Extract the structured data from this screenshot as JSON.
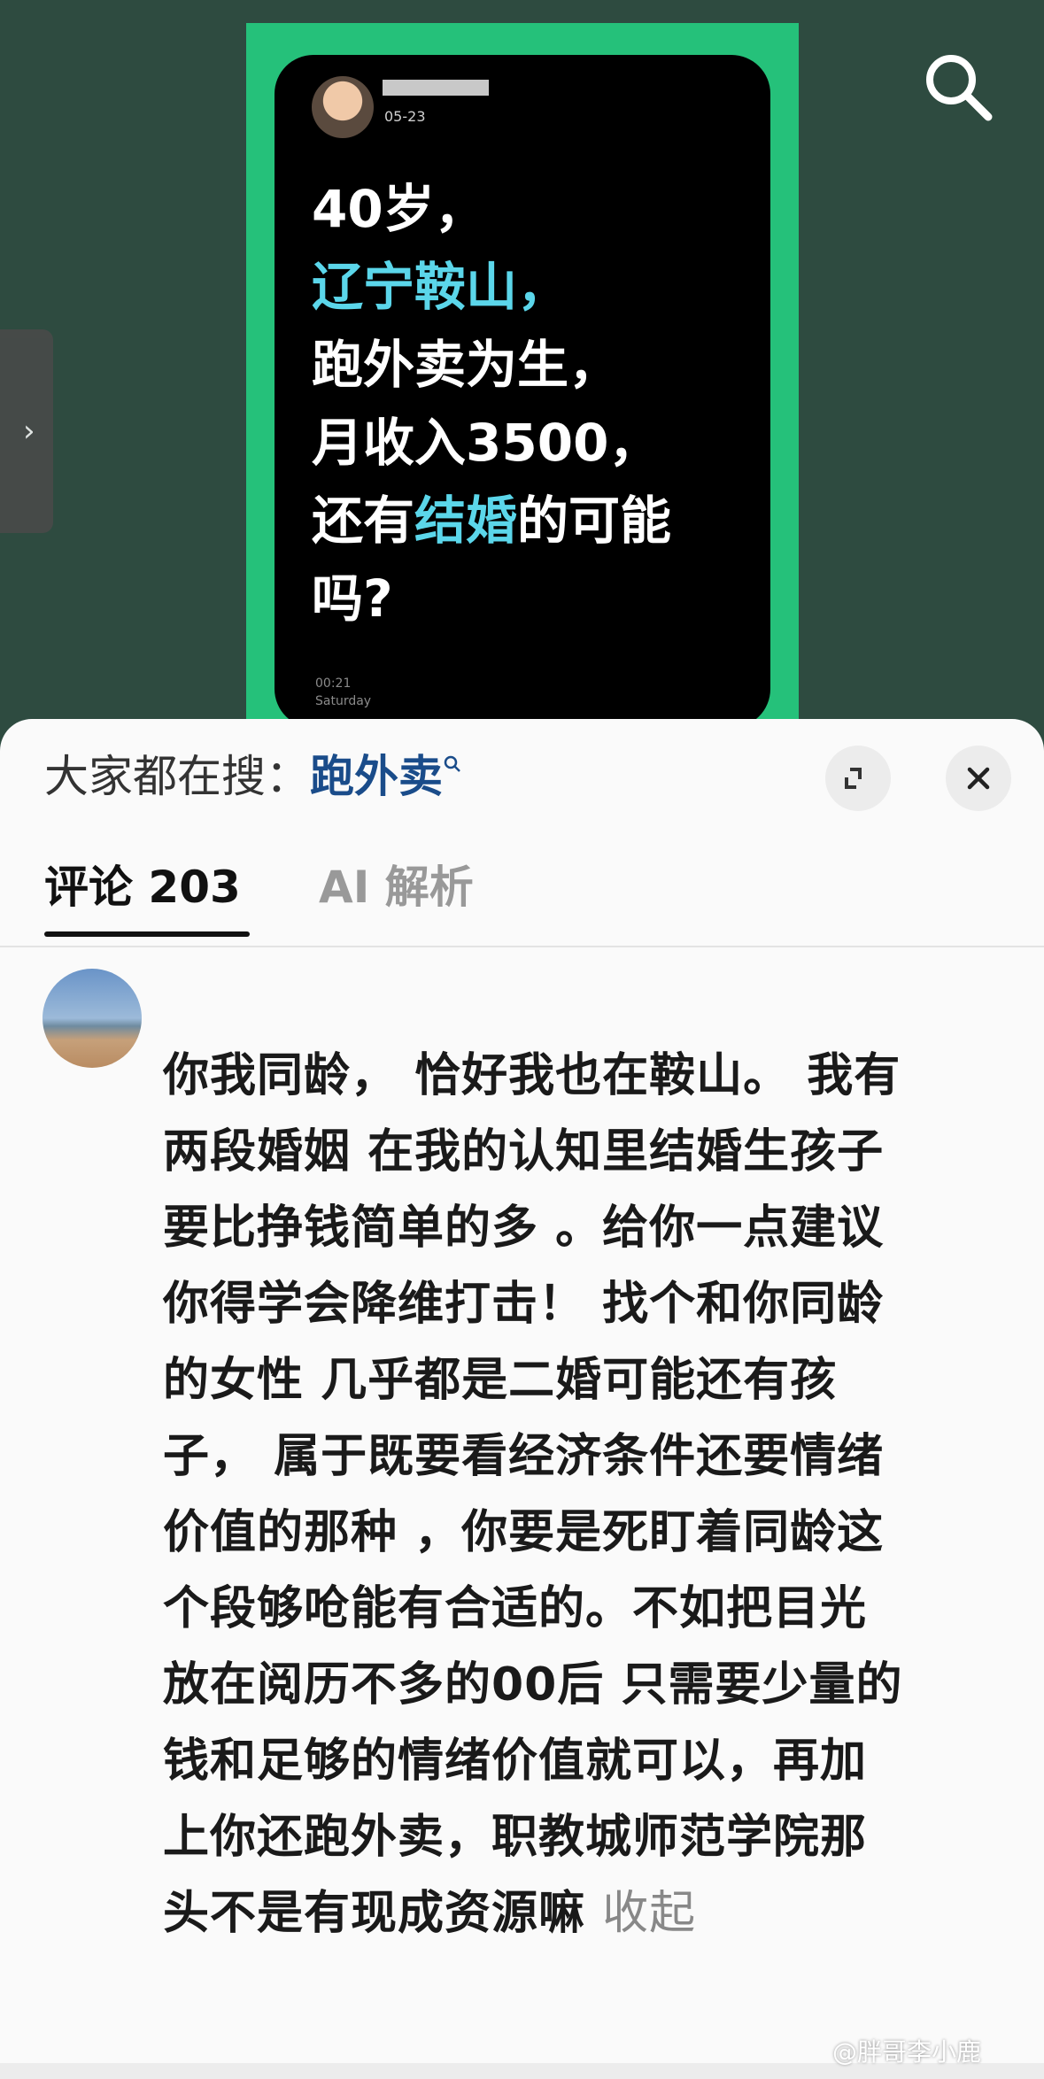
{
  "video": {
    "date": "05-23",
    "headline": {
      "line1": "40岁，",
      "line2": "辽宁鞍山，",
      "line3": "跑外卖为生，",
      "line4": "月收入3500，",
      "line5_a": "还有",
      "line5_b": "结婚",
      "line5_c": "的可能",
      "line6": "吗?"
    },
    "time": "00:21",
    "day": "Saturday",
    "highlight_color": "#5bd6ea"
  },
  "search": {
    "prefix": "大家都在搜：",
    "keyword": "跑外卖",
    "keyword_color": "#1a4c8a"
  },
  "tabs": {
    "comments": "评论 203",
    "ai": "AI 解析"
  },
  "comment": {
    "lines": [
      "你我同龄， 恰好我也在鞍山。 我有",
      "两段婚姻 在我的认知里结婚生孩子",
      "要比挣钱简单的多 。给你一点建议",
      "你得学会降维打击！ 找个和你同龄",
      "的女性 几乎都是二婚可能还有孩",
      "子， 属于既要看经济条件还要情绪",
      "价值的那种 ，你要是死盯着同龄这",
      "个段够呛能有合适的。不如把目光",
      "放在阅历不多的00后 只需要少量的",
      "钱和足够的情绪价值就可以，再加",
      "上你还跑外卖，职教城师范学院那",
      "头不是有现成资源嘛 "
    ],
    "collapse": "收起"
  },
  "watermark": "@胖哥李小鹿"
}
